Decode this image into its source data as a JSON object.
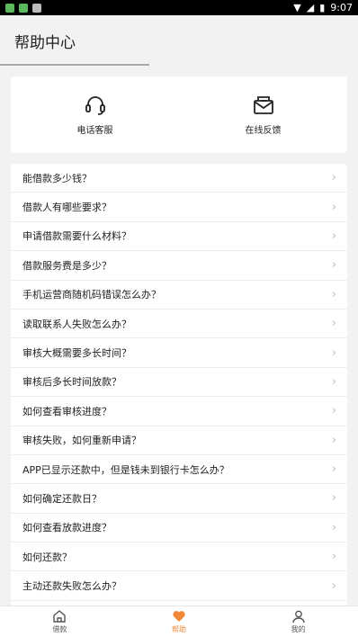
{
  "status_bar": {
    "time": "9:07"
  },
  "header": {
    "title": "帮助中心"
  },
  "contact": [
    {
      "label": "电话客服",
      "icon": "headset-icon"
    },
    {
      "label": "在线反馈",
      "icon": "mail-icon"
    }
  ],
  "faq": [
    "能借款多少钱？",
    "借款人有哪些要求？",
    "申请借款需要什么材料？",
    "借款服务费是多少？",
    "手机运营商随机码错误怎么办？",
    "读取联系人失败怎么办？",
    "审核大概需要多长时间？",
    "审核后多长时间放款？",
    "如何查看审核进度？",
    "审核失败，如何重新申请？",
    "APP已显示还款中，但是钱未到银行卡怎么办？",
    "如何确定还款日？",
    "如何查看放款进度？",
    "如何还款？",
    "主动还款失败怎么办？"
  ],
  "tabs": [
    {
      "label": "借款",
      "icon": "home-icon",
      "active": false
    },
    {
      "label": "帮助",
      "icon": "heart-icon",
      "active": true
    },
    {
      "label": "我的",
      "icon": "person-icon",
      "active": false
    }
  ],
  "colors": {
    "accent": "#f08838"
  }
}
